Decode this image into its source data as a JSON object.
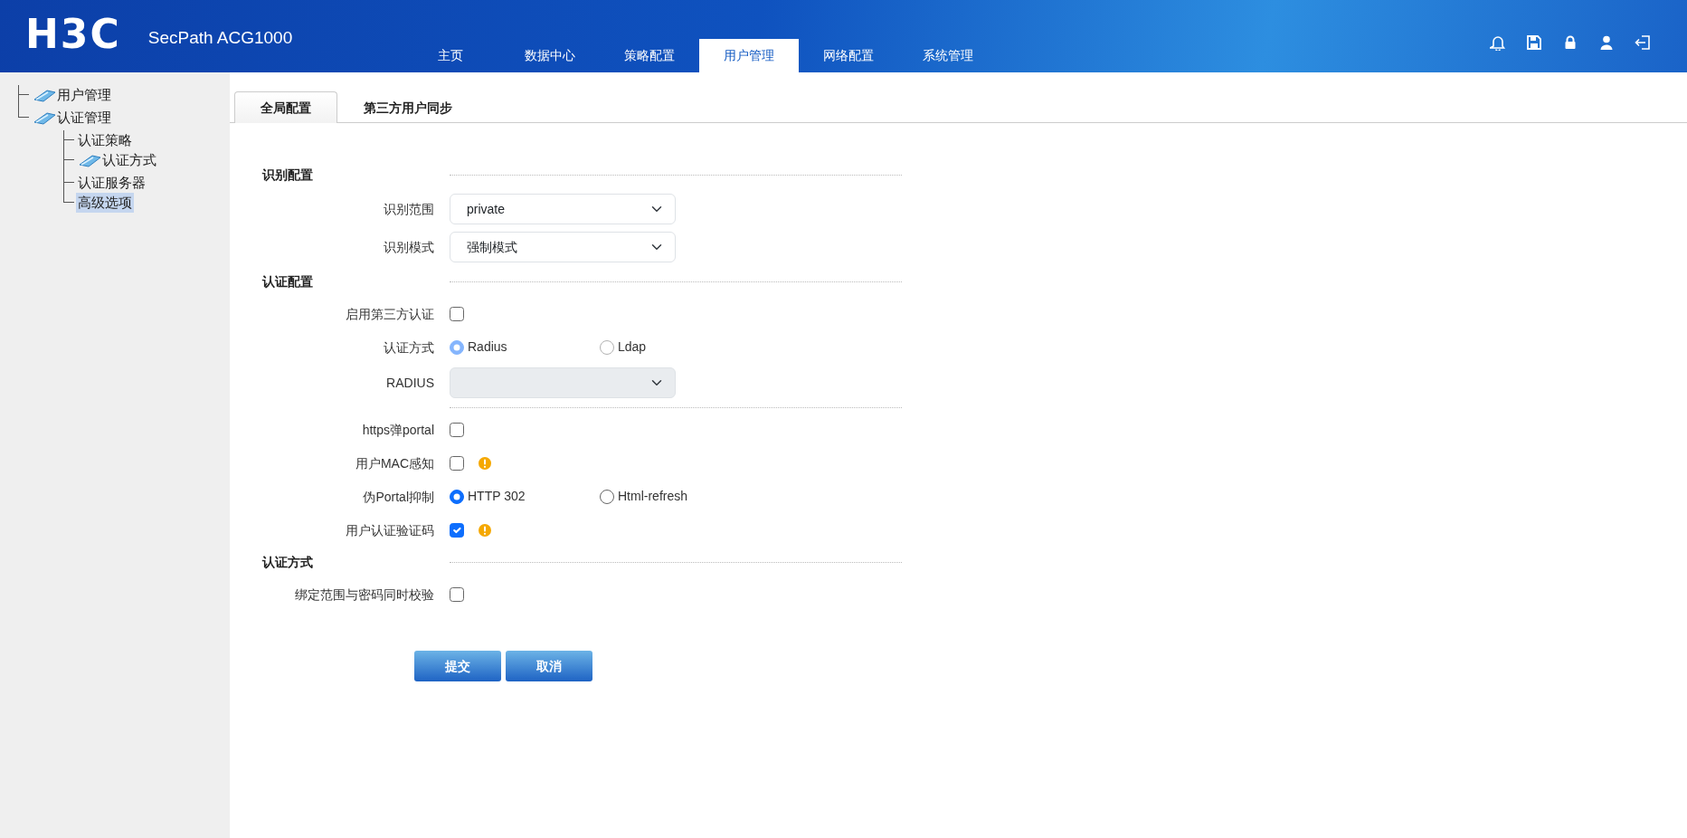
{
  "header": {
    "logo": "H3C",
    "product": "SecPath ACG1000",
    "nav": [
      {
        "label": "主页",
        "selected": false
      },
      {
        "label": "数据中心",
        "selected": false
      },
      {
        "label": "策略配置",
        "selected": false
      },
      {
        "label": "用户管理",
        "selected": true
      },
      {
        "label": "网络配置",
        "selected": false
      },
      {
        "label": "系统管理",
        "selected": false
      }
    ],
    "toolbar": [
      {
        "kind": "bell"
      },
      {
        "kind": "save"
      },
      {
        "kind": "lock"
      },
      {
        "kind": "user"
      },
      {
        "kind": "logout"
      }
    ]
  },
  "sidebar": {
    "tree": [
      {
        "label": "用户管理",
        "kind": "folder",
        "selected": false
      },
      {
        "label": "认证管理",
        "kind": "folder",
        "selected": false,
        "children": [
          {
            "label": "认证策略",
            "kind": "leaf",
            "selected": false
          },
          {
            "label": "认证方式",
            "kind": "folder",
            "selected": false
          },
          {
            "label": "认证服务器",
            "kind": "leaf",
            "selected": false
          },
          {
            "label": "高级选项",
            "kind": "leaf",
            "selected": true
          }
        ]
      }
    ]
  },
  "tabs": [
    {
      "label": "全局配置",
      "selected": true
    },
    {
      "label": "第三方用户同步",
      "selected": false
    }
  ],
  "sections": [
    {
      "title": "识别配置",
      "rows": [
        {
          "label": "识别范围",
          "kind": "select",
          "value": "private",
          "disabled": false
        },
        {
          "label": "识别模式",
          "kind": "select",
          "value": "强制模式",
          "disabled": false
        }
      ]
    },
    {
      "title": "认证配置",
      "rows": [
        {
          "label": "启用第三方认证",
          "kind": "checkbox",
          "checked": false,
          "warning": false
        },
        {
          "label": "认证方式",
          "kind": "radio",
          "options": [
            {
              "label": "Radius",
              "selected": true,
              "disabled": true
            },
            {
              "label": "Ldap",
              "selected": false,
              "disabled": true
            }
          ]
        },
        {
          "label": "RADIUS",
          "kind": "select",
          "disabled": true
        }
      ]
    },
    {
      "rows": [
        {
          "label": "https弹portal",
          "kind": "checkbox",
          "checked": false,
          "warning": false
        },
        {
          "label": "用户MAC感知",
          "kind": "checkbox",
          "checked": false,
          "warning": true
        },
        {
          "label": "伪Portal抑制",
          "kind": "radio",
          "options": [
            {
              "label": "HTTP 302",
              "selected": true,
              "disabled": false
            },
            {
              "label": "Html-refresh",
              "selected": false,
              "disabled": false
            }
          ]
        },
        {
          "label": "用户认证验证码",
          "kind": "checkbox",
          "checked": true,
          "warning": true
        }
      ]
    },
    {
      "title": "认证方式",
      "rows": [
        {
          "label": "绑定范围与密码同时校验",
          "kind": "checkbox",
          "checked": false,
          "warning": false
        }
      ]
    }
  ],
  "buttons": [
    "提交",
    "取消"
  ]
}
